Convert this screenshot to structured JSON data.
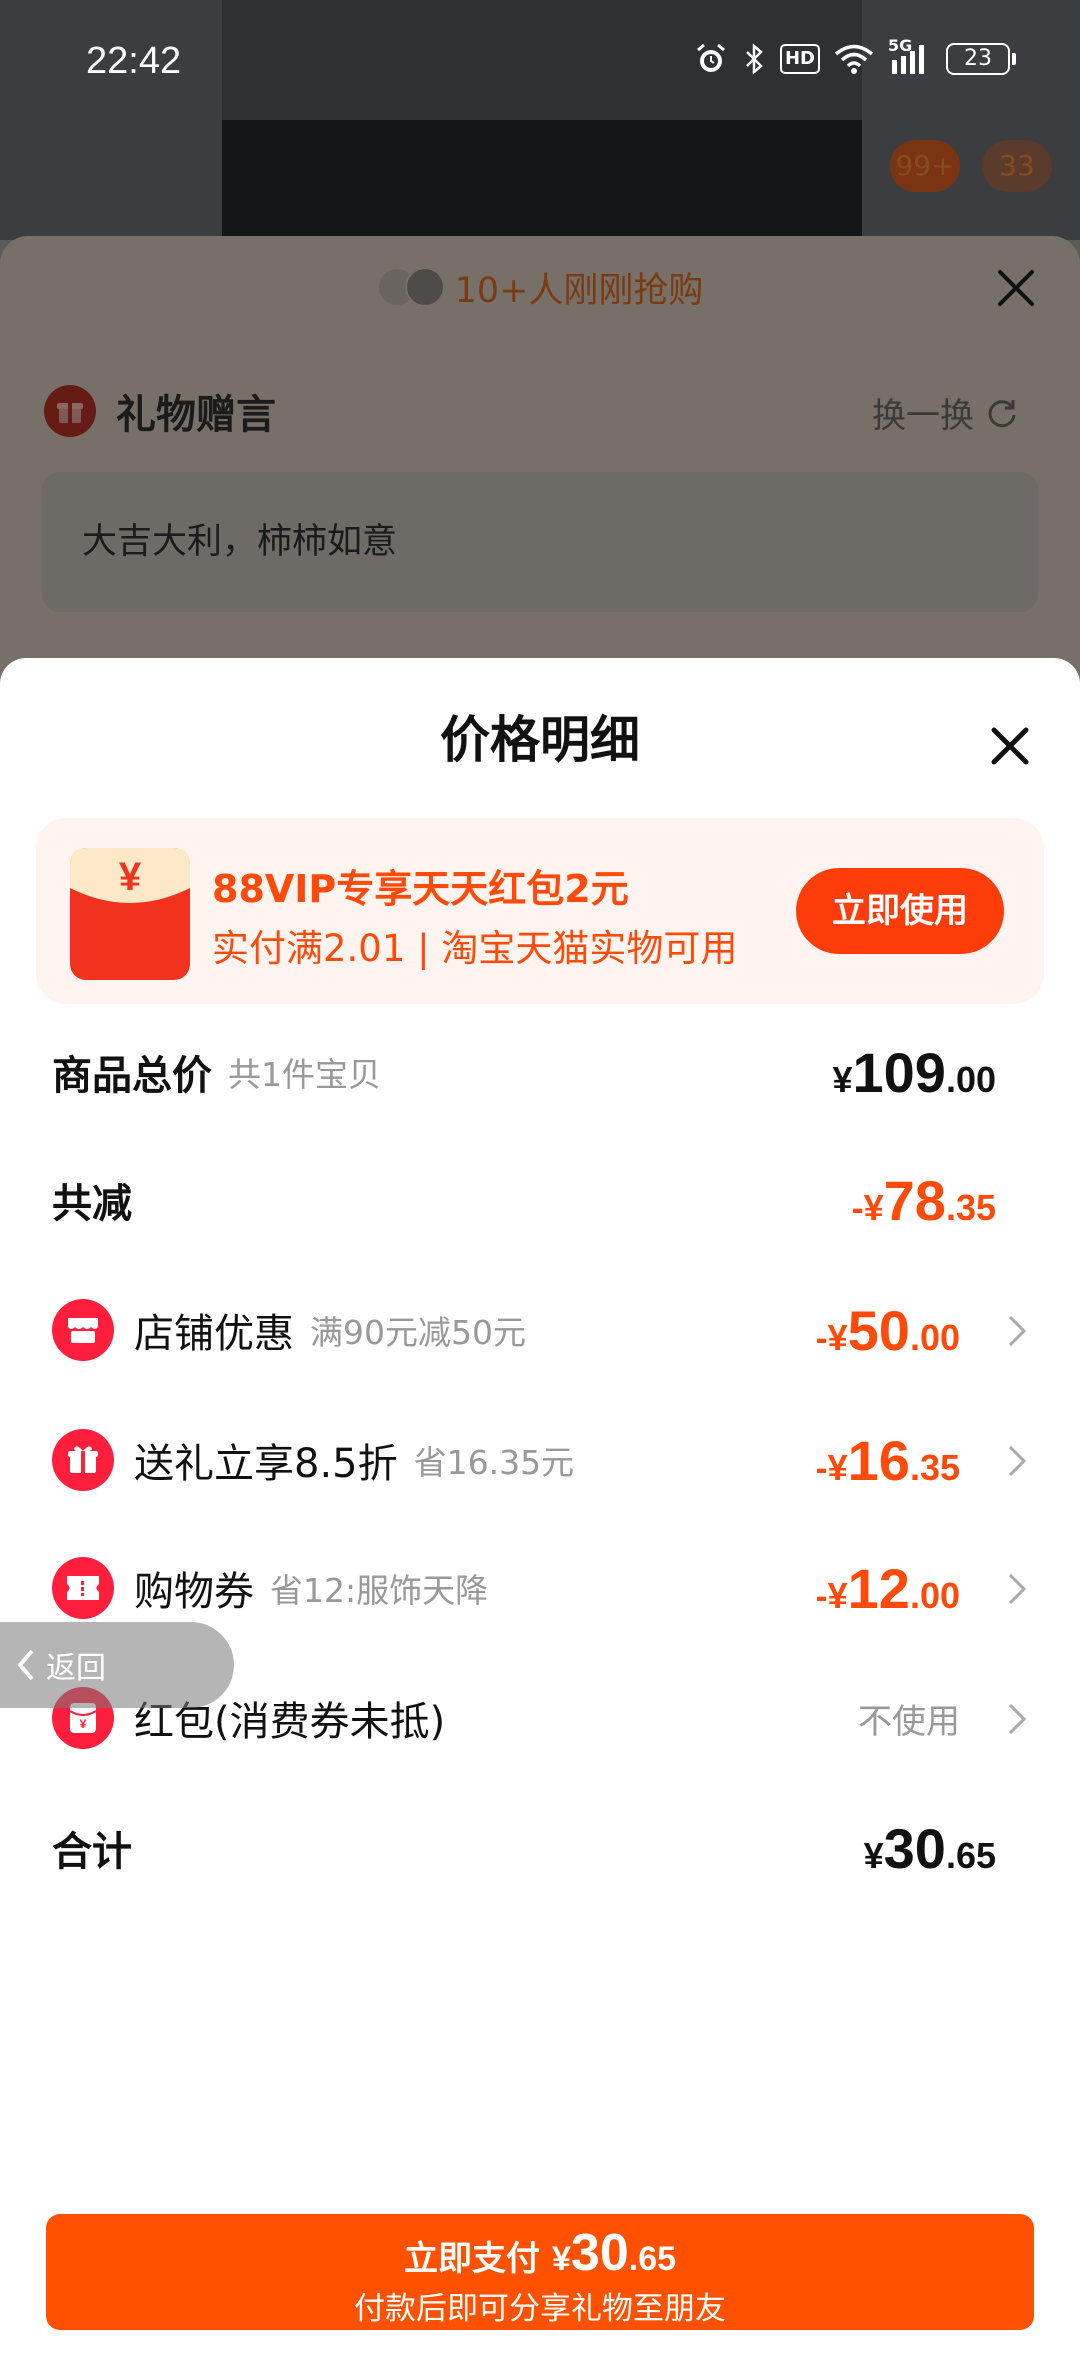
{
  "status_bar": {
    "time": "22:42",
    "hd_label": "HD",
    "network_label": "5G",
    "battery_level": "23"
  },
  "background": {
    "badge_1": "99+",
    "badge_2": "33",
    "buyers_text": "10+人刚刚抢购",
    "gift_title": "礼物赠言",
    "swap_label": "换一换",
    "gift_message": "大吉大利，柿柿如意"
  },
  "sheet": {
    "title": "价格明细"
  },
  "promo": {
    "title": "88VIP专享天天红包2元",
    "subtitle": "实付满2.01 | 淘宝天猫实物可用",
    "button_label": "立即使用",
    "icon_glyph": "¥"
  },
  "rows": {
    "total": {
      "label": "商品总价",
      "sub": "共1件宝贝",
      "currency": "¥",
      "int": "109",
      "dec": ".00"
    },
    "reduction": {
      "label": "共减",
      "currency": "-¥",
      "int": "78",
      "dec": ".35"
    },
    "shop_discount": {
      "label": "店铺优惠",
      "sub": "满90元减50元",
      "currency": "-¥",
      "int": "50",
      "dec": ".00"
    },
    "gift_discount": {
      "label": "送礼立享8.5折",
      "sub": "省16.35元",
      "currency": "-¥",
      "int": "16",
      "dec": ".35"
    },
    "coupon": {
      "label": "购物券",
      "sub": "省12:服饰天降",
      "currency": "-¥",
      "int": "12",
      "dec": ".00"
    },
    "red_packet": {
      "label": "红包(消费券未抵)",
      "value": "不使用",
      "icon_glyph": "¥"
    },
    "sum": {
      "label": "合计",
      "currency": "¥",
      "int": "30",
      "dec": ".65"
    }
  },
  "back_button": {
    "label": "返回"
  },
  "pay_button": {
    "label": "立即支付",
    "currency": "¥",
    "int": "30",
    "dec": ".65",
    "subtitle": "付款后即可分享礼物至朋友"
  },
  "colors": {
    "accent": "#ff4a0a",
    "pay_button": "#ff5100",
    "promo_background": "#fff4f0",
    "icon_red": "#ff1e3c"
  }
}
